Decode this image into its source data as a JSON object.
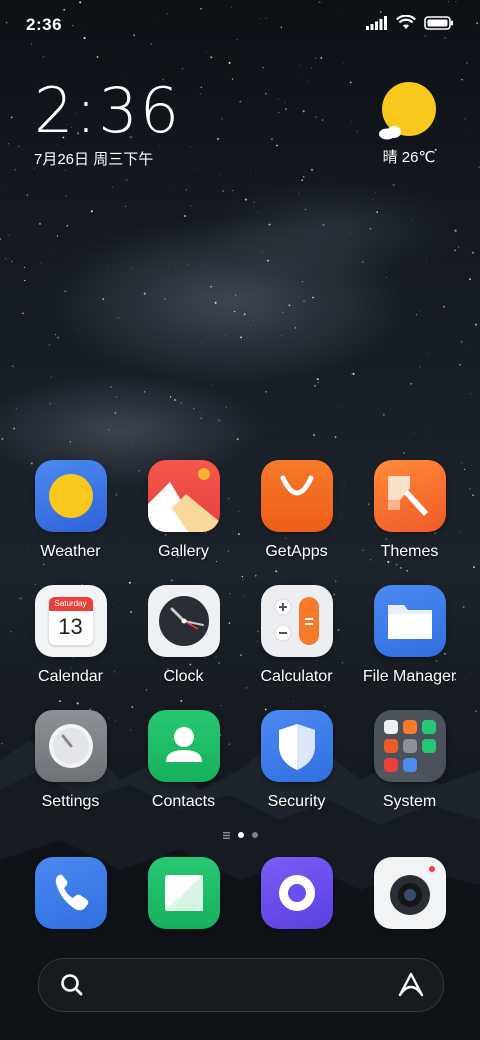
{
  "status_bar": {
    "time": "2:36",
    "icons": [
      "signal-icon",
      "wifi-icon",
      "battery-icon"
    ]
  },
  "clock_widget": {
    "time": "2:36",
    "date": "7月26日 周三下午"
  },
  "weather_widget": {
    "icon": "sun-icon",
    "text": "晴 26℃"
  },
  "apps": [
    {
      "label": "Weather",
      "icon": "weather-icon"
    },
    {
      "label": "Gallery",
      "icon": "gallery-icon"
    },
    {
      "label": "GetApps",
      "icon": "shopping-bag-icon"
    },
    {
      "label": "Themes",
      "icon": "brush-icon"
    },
    {
      "label": "Calendar",
      "icon": "calendar-icon",
      "day_name": "Saturday",
      "day_number": "13"
    },
    {
      "label": "Clock",
      "icon": "clock-icon"
    },
    {
      "label": "Calculator",
      "icon": "calculator-icon"
    },
    {
      "label": "File Manager",
      "icon": "folder-icon"
    },
    {
      "label": "Settings",
      "icon": "settings-knob-icon"
    },
    {
      "label": "Contacts",
      "icon": "person-icon"
    },
    {
      "label": "Security",
      "icon": "shield-icon"
    },
    {
      "label": "System",
      "icon": "folder-grid-icon"
    }
  ],
  "dock": [
    {
      "icon": "phone-icon"
    },
    {
      "icon": "messaging-icon"
    },
    {
      "icon": "browser-icon"
    },
    {
      "icon": "camera-icon"
    }
  ],
  "page_indicator": {
    "pages": 2,
    "current": 1
  },
  "search_bar": {
    "left_icon": "search-icon",
    "right_icon": "assistant-icon"
  },
  "colors": {
    "weather_bg": "#3f7ae8",
    "sun": "#f8c91c",
    "getapps": "#f36d21",
    "themes": "#f5702b",
    "calendar_red": "#e8403c",
    "contacts": "#1fbe6a",
    "security": "#3d7ff0",
    "file_manager": "#3b7ff0",
    "browser": "#6a4ef0"
  }
}
